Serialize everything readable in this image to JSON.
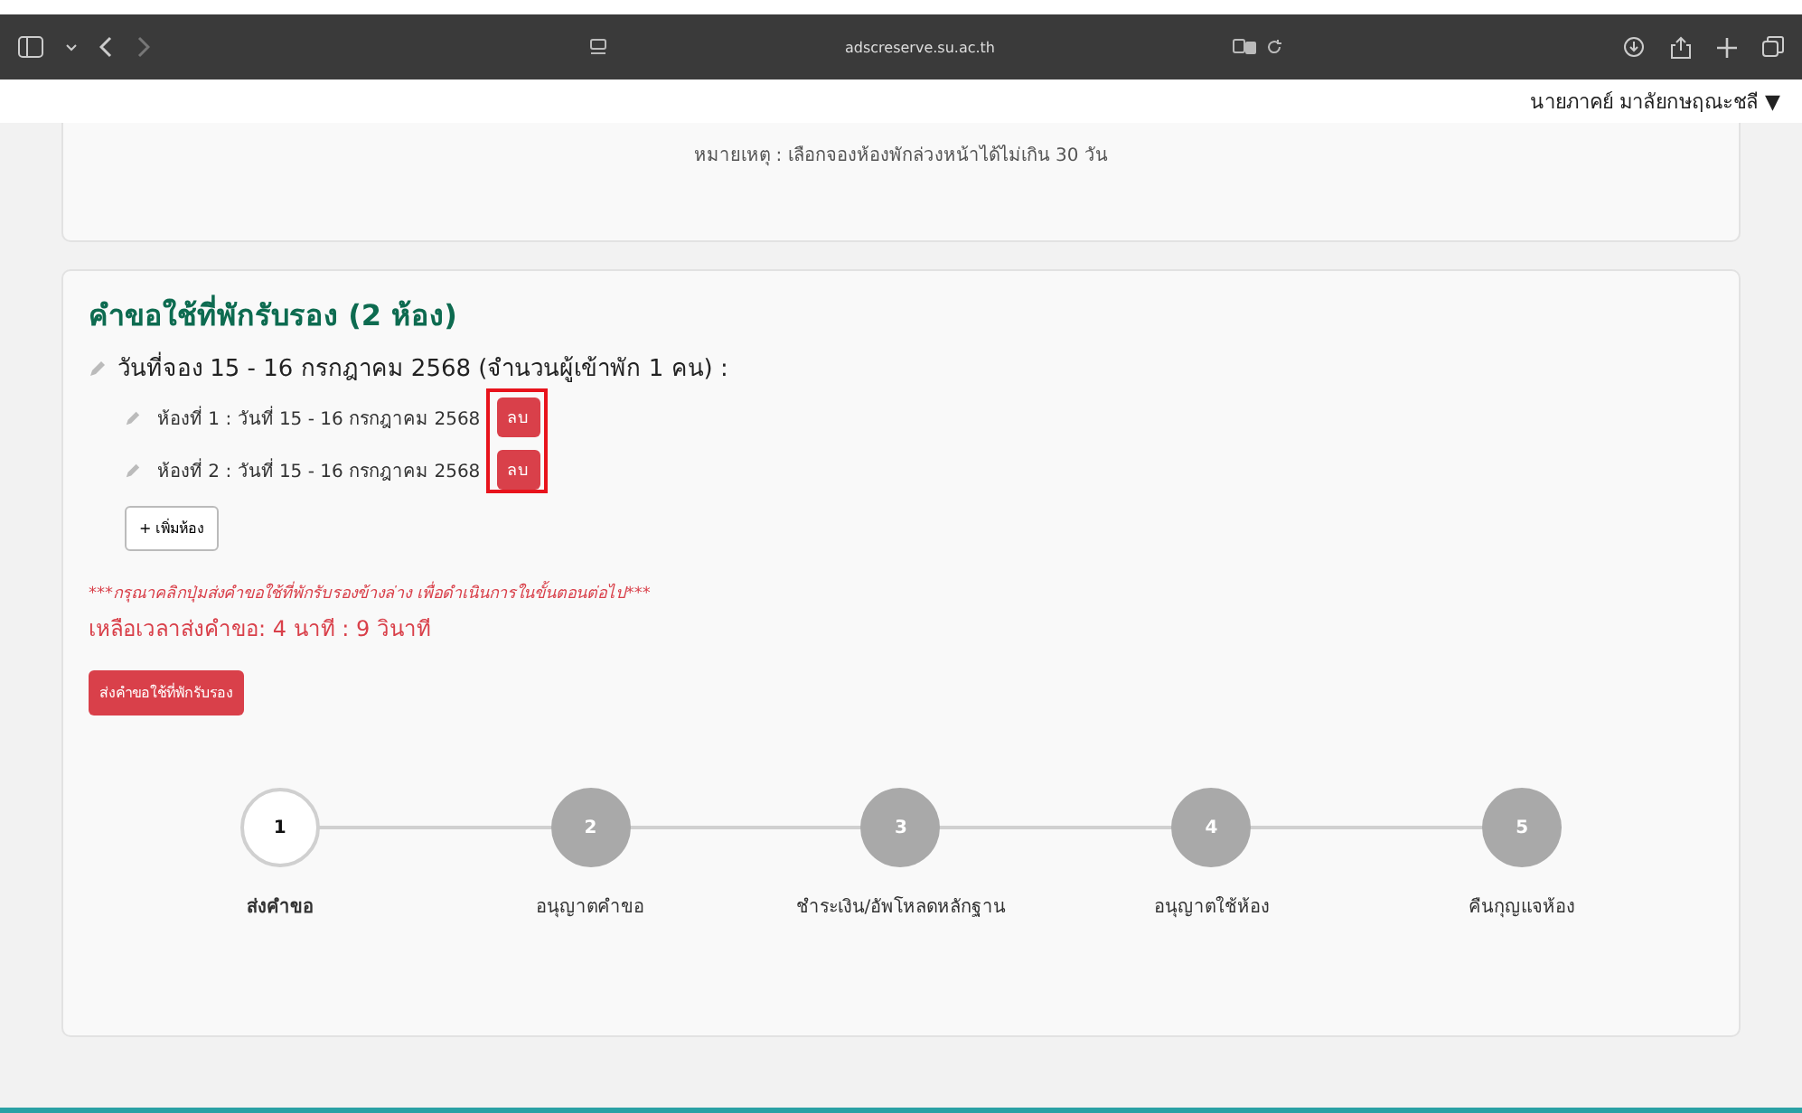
{
  "browser": {
    "url": "adscreserve.su.ac.th"
  },
  "user_menu": {
    "name": "นายภาคย์ มาลัยกษฤณะชลี",
    "caret": "▼"
  },
  "notice": "หมายเหตุ : เลือกจองห้องพักล่วงหน้าได้ไม่เกิน 30 วัน",
  "request": {
    "title": "คำขอใช้ที่พักรับรอง (2 ห้อง)",
    "booking": "วันที่จอง 15 - 16 กรกฎาคม 2568 (จำนวนผู้เข้าพัก 1 คน) :",
    "rooms": [
      {
        "label": "ห้องที่ 1 :  วันที่ 15 - 16 กรกฎาคม 2568",
        "delete": "ลบ"
      },
      {
        "label": "ห้องที่ 2 :  วันที่ 15 - 16 กรกฎาคม 2568",
        "delete": "ลบ"
      }
    ],
    "add_room": "+ เพิ่มห้อง",
    "instruction": "***กรุณาคลิกปุ่มส่งคำขอใช้ที่พักรับรองข้างล่าง เพื่อดำเนินการในขั้นตอนต่อไป***",
    "countdown": "เหลือเวลาส่งคำขอ: 4 นาที : 9 วินาที",
    "submit": "ส่งคำขอใช้ที่พักรับรอง"
  },
  "steps": [
    {
      "number": "1",
      "label": "ส่งคำขอ",
      "selected": true
    },
    {
      "number": "2",
      "label": "อนุญาตคำขอ",
      "selected": false
    },
    {
      "number": "3",
      "label": "ชำระเงิน/อัพโหลดหลักฐาน",
      "selected": false
    },
    {
      "number": "4",
      "label": "อนุญาตใช้ห้อง",
      "selected": false
    },
    {
      "number": "5",
      "label": "คืนกุญแจห้อง",
      "selected": false
    }
  ]
}
